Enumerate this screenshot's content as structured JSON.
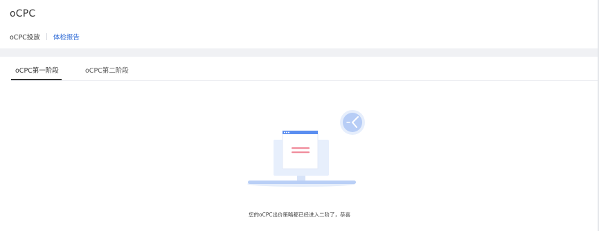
{
  "header": {
    "title": "oCPC",
    "subnav": [
      {
        "label": "oCPC投放"
      },
      {
        "label": "体检报告"
      }
    ]
  },
  "tabs": [
    {
      "label": "oCPC第一阶段",
      "active": true
    },
    {
      "label": "oCPC第二阶段",
      "active": false
    }
  ],
  "empty_state": {
    "icon": "monitor-with-clock-illustration",
    "message": "您的oCPC出价策略都已经进入二阶了，恭喜"
  },
  "colors": {
    "link": "#2f6bd6",
    "page_background": "#f0f1f4",
    "accent_blue": "#5b8ef0",
    "accent_pink": "#f08a9a"
  }
}
